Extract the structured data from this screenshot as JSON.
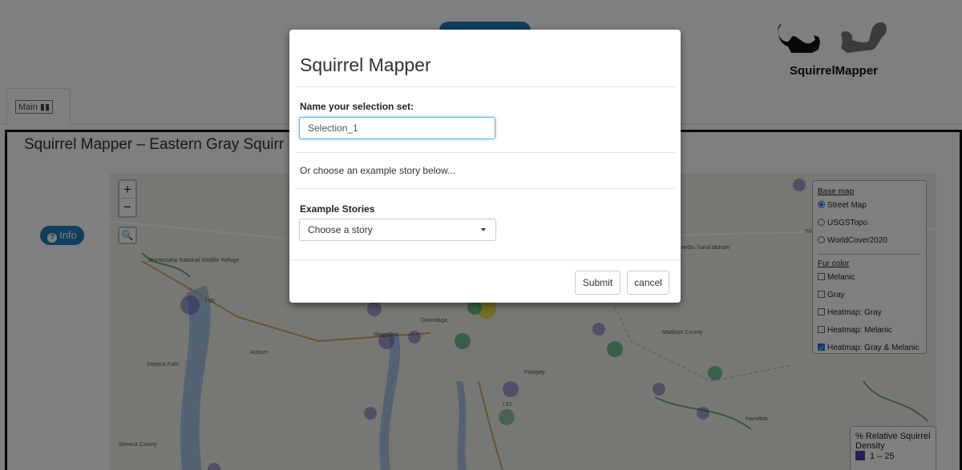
{
  "header": {
    "selection_button_label": "",
    "logo_text": "SquirrelMapper",
    "main_tab_label": "Main"
  },
  "page": {
    "title": "Squirrel Mapper – Eastern Gray Squirr",
    "info_button_label": "Info"
  },
  "map": {
    "zoom_in": "+",
    "zoom_out": "−",
    "labels": [
      "Montezuma National Wildlife Refuge",
      "I 90",
      "Seneca Falls",
      "Auburn",
      "Onondaga",
      "Marcellus",
      "Pompey",
      "Madison County",
      "Hamilton",
      "Seneca County",
      "I 81",
      "neida / kanáʼalohaleʼ",
      "We"
    ],
    "layer_panel": {
      "base_map_heading": "Base map",
      "base_maps": [
        {
          "label": "Street Map",
          "selected": true
        },
        {
          "label": "USGSTopo",
          "selected": false
        },
        {
          "label": "WorldCover2020",
          "selected": false
        }
      ],
      "fur_color_heading": "Fur color",
      "fur_colors": [
        {
          "label": "Melanic",
          "checked": false
        },
        {
          "label": "Gray",
          "checked": false
        },
        {
          "label": "Heatmap: Gray",
          "checked": false
        },
        {
          "label": "Heatmap: Melanic",
          "checked": false
        },
        {
          "label": "Heatmap: Gray & Melanic",
          "checked": true
        }
      ]
    },
    "legend": {
      "title": "% Relative Squirrel Density",
      "first_entry": "1 – 25",
      "first_color": "#4a3fb0"
    }
  },
  "modal": {
    "title": "Squirrel Mapper",
    "name_label": "Name your selection set:",
    "name_value": "Selection_1",
    "hint": "Or choose an example story below...",
    "stories_label": "Example Stories",
    "stories_selected": "Choose a story",
    "submit_label": "Submit",
    "cancel_label": "cancel"
  },
  "colors": {
    "accent": "#1f7fb8",
    "focus": "#66afe9"
  }
}
